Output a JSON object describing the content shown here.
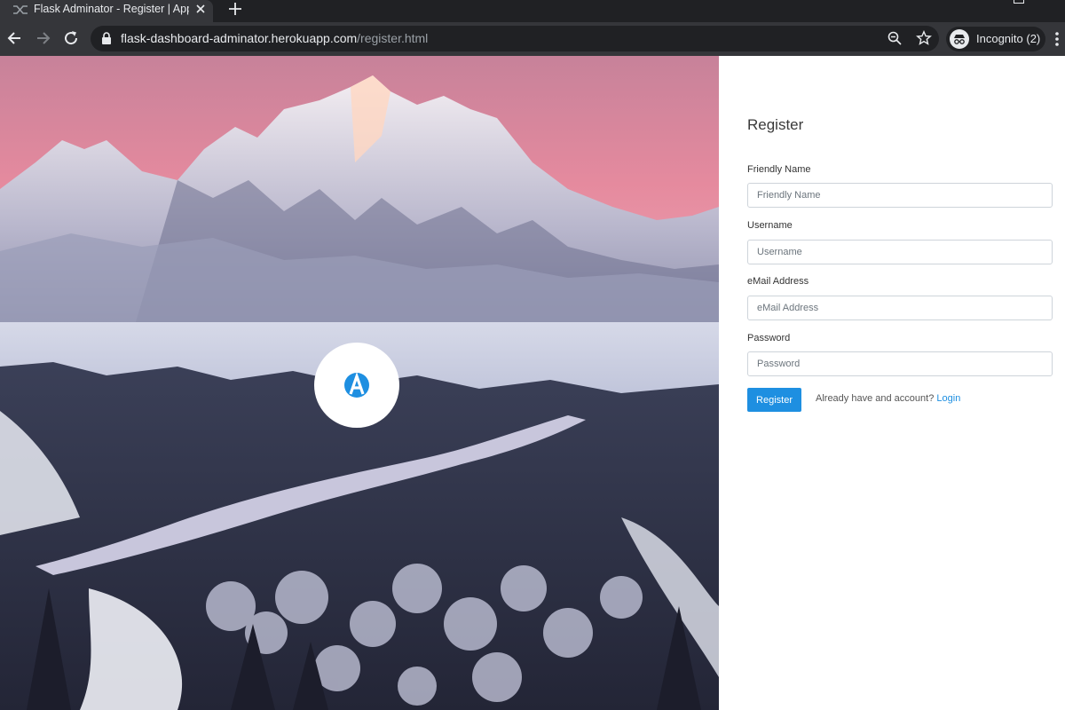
{
  "browser": {
    "tab_title": "Flask Adminator - Register | AppSeed",
    "url_host": "flask-dashboard-adminator.herokuapp.com",
    "url_path": "/register.html",
    "profile_label": "Incognito (2)"
  },
  "form": {
    "title": "Register",
    "fields": [
      {
        "label": "Friendly Name",
        "placeholder": "Friendly Name",
        "value": ""
      },
      {
        "label": "Username",
        "placeholder": "Username",
        "value": ""
      },
      {
        "label": "eMail Address",
        "placeholder": "eMail Address",
        "value": ""
      },
      {
        "label": "Password",
        "placeholder": "Password",
        "value": ""
      }
    ],
    "submit_label": "Register",
    "login_prompt": "Already have and account?",
    "login_link": "Login"
  },
  "colors": {
    "accent": "#1e8fe1",
    "chrome_dark": "#202124",
    "chrome_toolbar": "#35363a",
    "sky_pink": "#e58a9e"
  },
  "icons": [
    "tab-favicon-icon",
    "close-icon",
    "plus-icon",
    "back-arrow-icon",
    "forward-arrow-icon",
    "reload-icon",
    "lock-icon",
    "zoom-icon",
    "star-icon",
    "incognito-icon",
    "kebab-menu-icon",
    "adminator-logo-icon"
  ]
}
